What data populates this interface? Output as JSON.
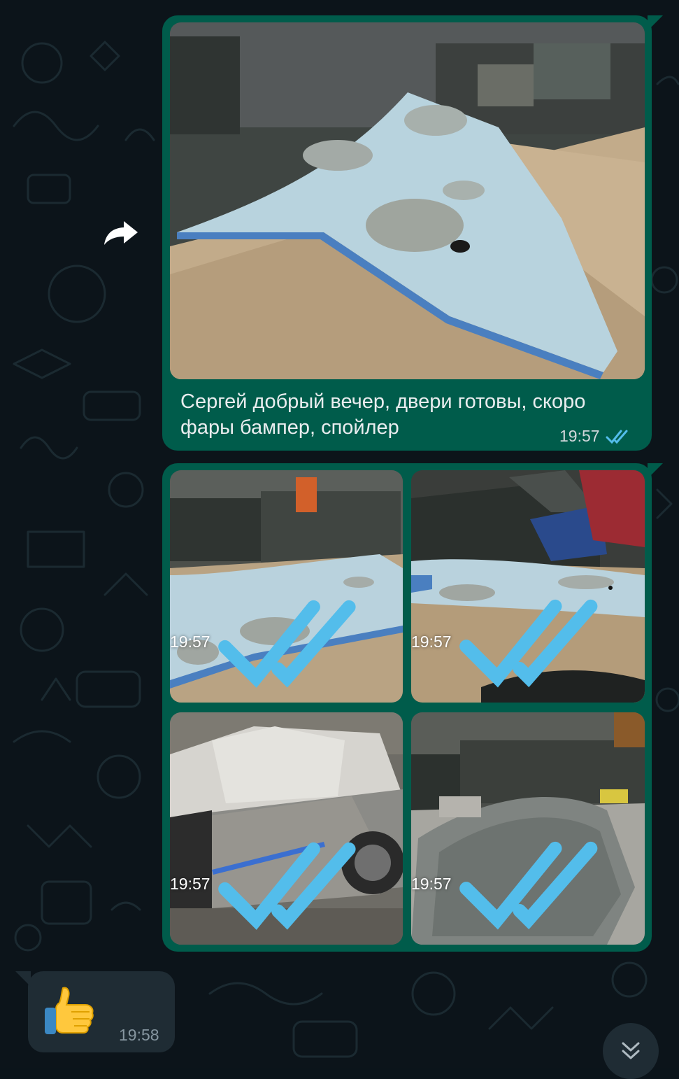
{
  "wallpaper": {
    "background": "#0c141a",
    "doodle_color": "#1b2a31"
  },
  "forward": {
    "icon": "forward-arrow-icon"
  },
  "messages": [
    {
      "type": "image-with-caption",
      "direction": "outgoing",
      "bubble_color": "#005c4b",
      "caption": "Сергей добрый вечер, двери готовы, скоро фары бампер, спойлер",
      "time": "19:57",
      "status": "read",
      "status_color": "#53bdeb"
    },
    {
      "type": "image-album",
      "direction": "outgoing",
      "bubble_color": "#005c4b",
      "photos": [
        {
          "time": "19:57",
          "status": "read",
          "icon": "photo-fender-closeup"
        },
        {
          "time": "19:57",
          "status": "read",
          "icon": "photo-fender-car-bg"
        },
        {
          "time": "19:57",
          "status": "read",
          "icon": "photo-car-side-primer"
        },
        {
          "time": "19:57",
          "status": "read",
          "icon": "photo-hood-workshop"
        }
      ]
    },
    {
      "type": "emoji",
      "direction": "incoming",
      "bubble_color": "#1f2c34",
      "emoji": "👍",
      "emoji_icon": "thumbs-up-icon",
      "time": "19:58"
    }
  ],
  "scroll_button": {
    "icon": "double-chevron-down-icon"
  }
}
